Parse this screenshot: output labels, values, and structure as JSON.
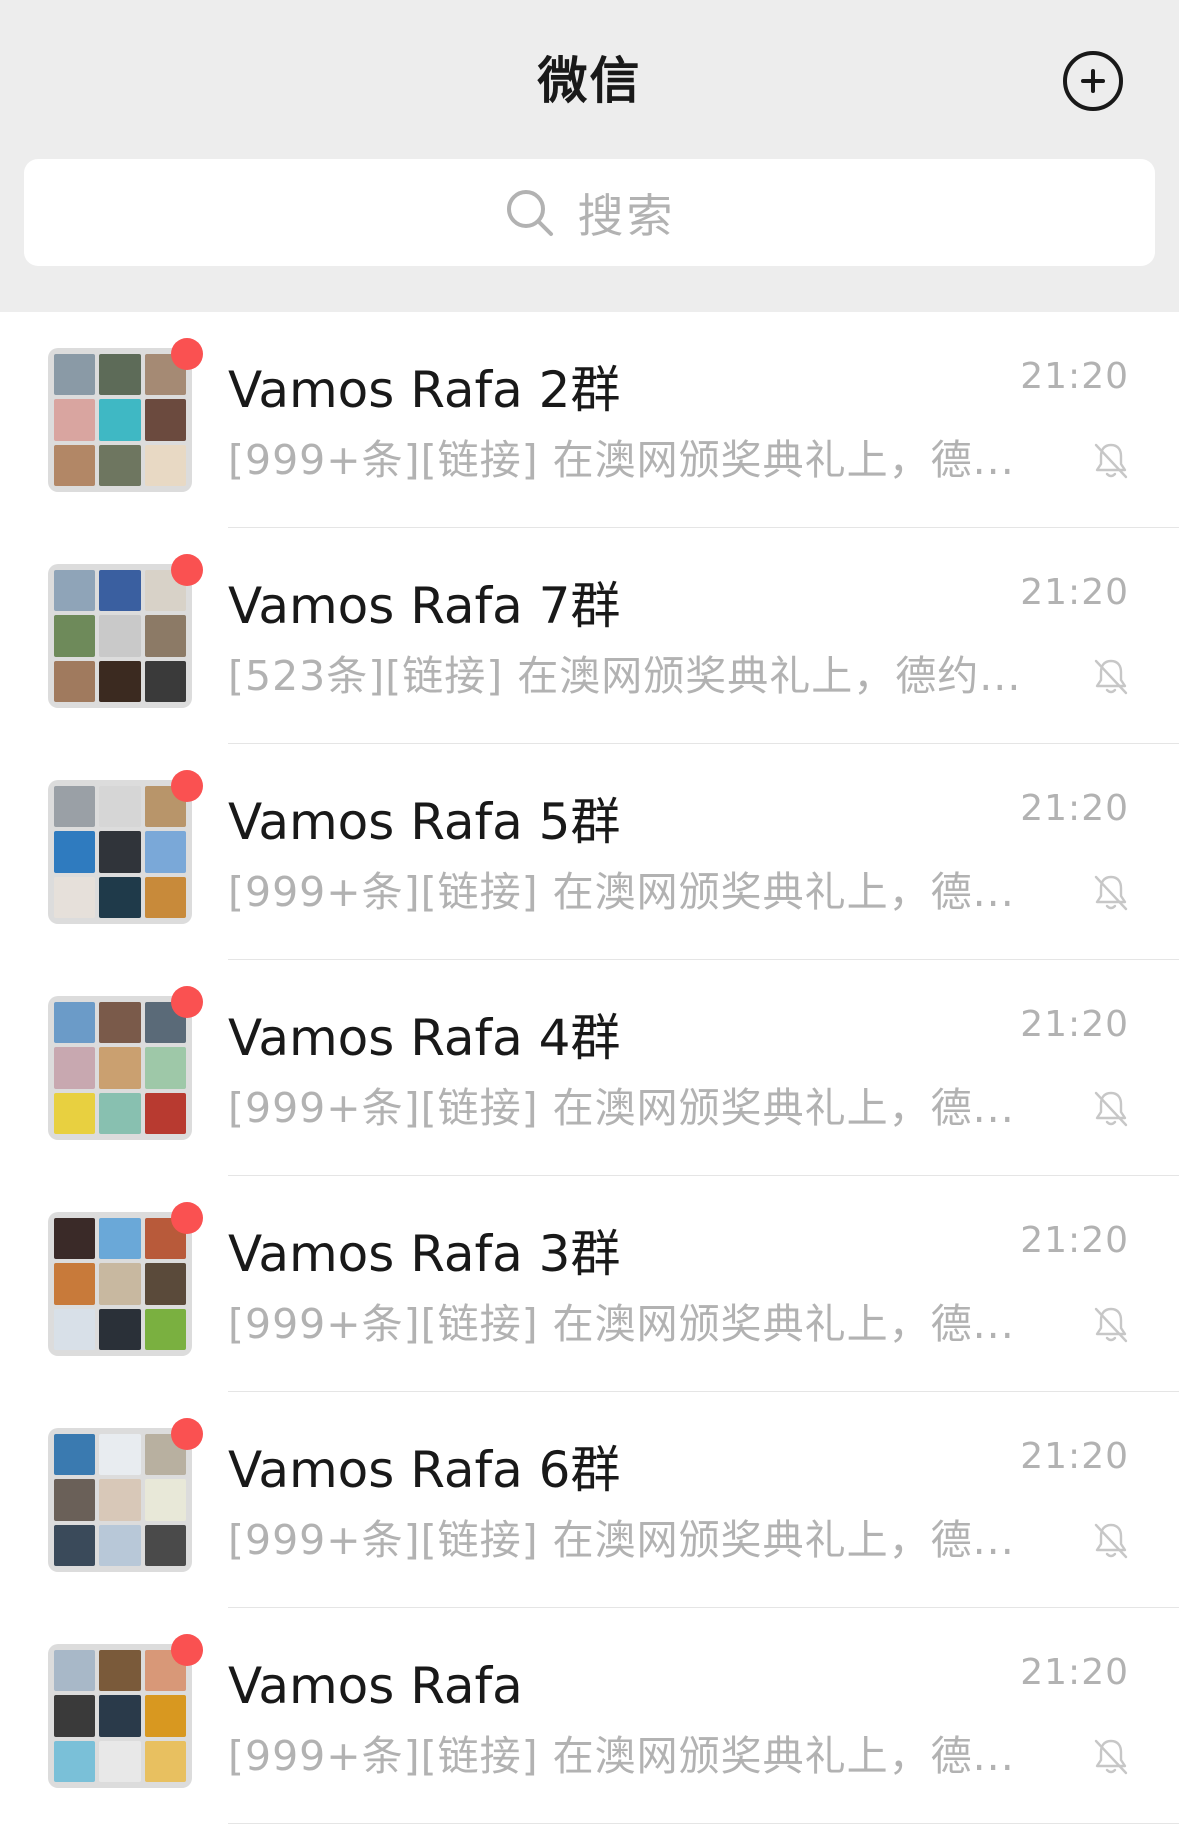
{
  "header": {
    "title": "微信",
    "add_icon": "plus-circle-icon"
  },
  "search": {
    "placeholder": "搜索",
    "icon": "search-icon"
  },
  "colors": {
    "background_top": "#ededed",
    "badge": "#fa5151",
    "secondary_text": "#b2b2b2"
  },
  "chats": [
    {
      "name": "Vamos Rafa 2群",
      "time": "21:20",
      "preview": "[999+条][链接] 在澳网颁奖典礼上，德...",
      "unread_dot": true,
      "muted": true,
      "avatar_tiles": [
        "#8a9aa6",
        "#5d6b58",
        "#a58a74",
        "#d9a5a0",
        "#3fb8c4",
        "#6b4a3e",
        "#b28766",
        "#6e7660",
        "#e8d9c4"
      ]
    },
    {
      "name": "Vamos Rafa 7群",
      "time": "21:20",
      "preview": "[523条][链接] 在澳网颁奖典礼上，德约...",
      "unread_dot": true,
      "muted": true,
      "avatar_tiles": [
        "#8fa4b8",
        "#3a5fa0",
        "#d8d2c8",
        "#6e8a5a",
        "#c9c9c9",
        "#8c7a66",
        "#a07a5e",
        "#3b2a20",
        "#3a3a3a"
      ]
    },
    {
      "name": "Vamos Rafa 5群",
      "time": "21:20",
      "preview": "[999+条][链接] 在澳网颁奖典礼上，德...",
      "unread_dot": true,
      "muted": true,
      "avatar_tiles": [
        "#9aa0a6",
        "#d6d6d6",
        "#b8956a",
        "#2f7bbf",
        "#30343a",
        "#7aa8d8",
        "#e6e0da",
        "#1f3a4a",
        "#c88a3a"
      ]
    },
    {
      "name": "Vamos Rafa 4群",
      "time": "21:20",
      "preview": "[999+条][链接] 在澳网颁奖典礼上，德...",
      "unread_dot": true,
      "muted": true,
      "avatar_tiles": [
        "#6b9bc8",
        "#7a5a4a",
        "#5a6a78",
        "#c8a8b0",
        "#caa070",
        "#9ec8a8",
        "#e8d040",
        "#88c0b0",
        "#b83a30"
      ]
    },
    {
      "name": "Vamos Rafa 3群",
      "time": "21:20",
      "preview": "[999+条][链接] 在澳网颁奖典礼上，德...",
      "unread_dot": true,
      "muted": true,
      "avatar_tiles": [
        "#3a2a28",
        "#6aa8d8",
        "#b85a3a",
        "#c87a3a",
        "#c8b8a0",
        "#5a4a3a",
        "#d8e0e8",
        "#2a3038",
        "#7ab040"
      ]
    },
    {
      "name": "Vamos Rafa 6群",
      "time": "21:20",
      "preview": "[999+条][链接] 在澳网颁奖典礼上，德...",
      "unread_dot": true,
      "muted": true,
      "avatar_tiles": [
        "#3a7ab0",
        "#e8ecf0",
        "#b8b0a0",
        "#6a6058",
        "#d8c8b8",
        "#e8e8d8",
        "#3a4a5a",
        "#b8c8d8",
        "#4a4a4a"
      ]
    },
    {
      "name": "Vamos Rafa",
      "time": "21:20",
      "preview": "[999+条][链接] 在澳网颁奖典礼上，德...",
      "unread_dot": true,
      "muted": true,
      "avatar_tiles": [
        "#a8b8c8",
        "#7a5a3a",
        "#d89878",
        "#3a3a3a",
        "#2a3a4a",
        "#d89820",
        "#7ac0d8",
        "#e8e8e8",
        "#e8c060"
      ]
    }
  ]
}
